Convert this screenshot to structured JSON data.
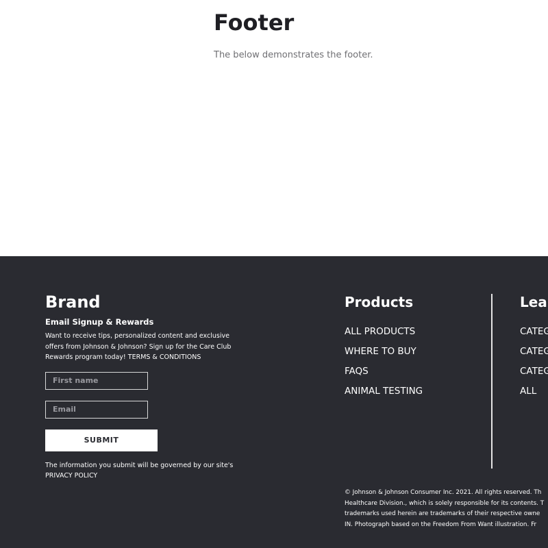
{
  "header": {
    "title": "Footer",
    "description": "The below demonstrates the footer."
  },
  "footer": {
    "brand": {
      "name": "Brand",
      "signup_title": "Email Signup & Rewards",
      "signup_text": "Want to receive tips, personalized content and exclusive offers from Johnson & Johnson? Sign up for the Care Club Rewards program today!",
      "terms_link": "TERMS & CONDITIONS",
      "first_name_placeholder": "First name",
      "email_placeholder": "Email",
      "submit_label": "SUBMIT",
      "privacy_text": "The information you submit will be governed by our site's",
      "privacy_link": "PRIVACY POLICY"
    },
    "products": {
      "heading": "Products",
      "links": [
        "ALL PRODUCTS",
        "WHERE TO BUY",
        "FAQS",
        "ANIMAL TESTING"
      ]
    },
    "learn": {
      "heading": "Lear",
      "links": [
        "CATEG",
        "CATEG",
        "CATEG",
        "ALL"
      ]
    },
    "legal": [
      "© Johnson & Johnson Consumer Inc. 2021. All rights reserved. Th",
      "Healthcare Division., which is solely responsible for its contents. T",
      "trademarks used herein are trademarks of their respective owne",
      "IN. Photograph based on the Freedom From Want illustration. Fr"
    ],
    "colors": {
      "background": "#2a2b31",
      "text": "#ffffff",
      "divider": "#e6e6e6"
    }
  }
}
